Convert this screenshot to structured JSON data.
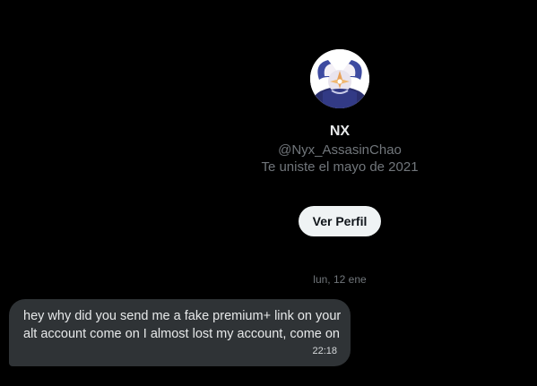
{
  "profile": {
    "avatar_icon": "character-avatar",
    "name": "NX",
    "handle": "@Nyx_AssasinChao",
    "joined": "Te uniste el mayo de 2021",
    "view_profile_label": "Ver Perfil"
  },
  "conversation": {
    "date_separator": "lun, 12 ene",
    "messages": [
      {
        "text": "hey why did you send me a fake premium+ link on your alt account come on I almost lost my account, come on",
        "time": "22:18"
      }
    ]
  },
  "colors": {
    "background": "#000000",
    "bubble": "#2f3336",
    "primary_text": "#e7e9ea",
    "secondary_text": "#71767b",
    "button_bg": "#eff3f4"
  }
}
